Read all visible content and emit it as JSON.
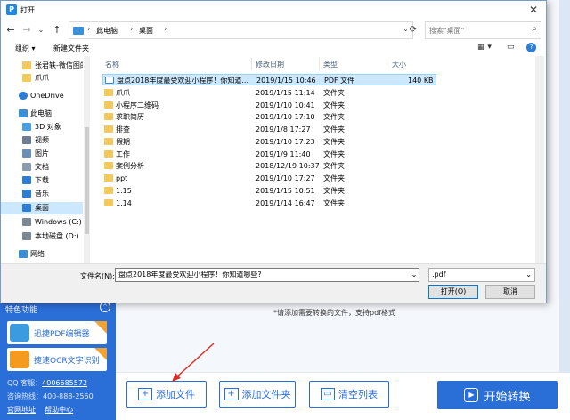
{
  "dialog": {
    "title": "打开",
    "close": "✕",
    "nav": {
      "back": "←",
      "forward": "→",
      "recent": "⌄",
      "up": "↑"
    },
    "address": {
      "crumbs": [
        "此电脑",
        "桌面"
      ],
      "sep": "›",
      "drop": "⌄"
    },
    "refresh": "⟳",
    "search_placeholder": "搜索\"桌面\"",
    "search_icon": "⌕",
    "toolbar": {
      "organize": "组织 ▾",
      "new_folder": "新建文件夹",
      "view": "▦ ▾",
      "pane": "▭",
      "help": "?"
    },
    "sidebar": [
      {
        "label": "张君轶-微信图的",
        "icon": "folder",
        "color": "#f5c85a"
      },
      {
        "label": "爪爪",
        "icon": "folder",
        "color": "#f5c85a"
      },
      {
        "label": "OneDrive",
        "icon": "cloud",
        "color": "#2d7cd6"
      },
      {
        "label": "此电脑",
        "icon": "computer",
        "color": "#3a8fd8"
      },
      {
        "label": "3D 对象",
        "icon": "cube",
        "color": "#4aa0e6"
      },
      {
        "label": "视频",
        "icon": "video",
        "color": "#6b7c93"
      },
      {
        "label": "图片",
        "icon": "picture",
        "color": "#6b8fb8"
      },
      {
        "label": "文档",
        "icon": "document",
        "color": "#8a9bb0"
      },
      {
        "label": "下载",
        "icon": "download",
        "color": "#2d7cd6"
      },
      {
        "label": "音乐",
        "icon": "music",
        "color": "#2d7cd6"
      },
      {
        "label": "桌面",
        "icon": "desktop",
        "color": "#2d7cd6",
        "selected": true
      },
      {
        "label": "Windows (C:)",
        "icon": "drive",
        "color": "#7c8894"
      },
      {
        "label": "本地磁盘 (D:)",
        "icon": "drive",
        "color": "#7c8894"
      },
      {
        "label": "网络",
        "icon": "network",
        "color": "#3a8fd8"
      }
    ],
    "columns": [
      "名称",
      "修改日期",
      "类型",
      "大小"
    ],
    "files": [
      {
        "name": "盘点2018年度最受欢迎小程序！你知道...",
        "date": "2019/1/15 10:46",
        "type": "PDF 文件",
        "size": "140 KB",
        "pdf": true,
        "selected": true
      },
      {
        "name": "爪爪",
        "date": "2019/1/15 11:14",
        "type": "文件夹",
        "size": ""
      },
      {
        "name": "小程序二维码",
        "date": "2019/1/10 10:41",
        "type": "文件夹",
        "size": ""
      },
      {
        "name": "求职简历",
        "date": "2019/1/10 17:10",
        "type": "文件夹",
        "size": ""
      },
      {
        "name": "排查",
        "date": "2019/1/8 17:27",
        "type": "文件夹",
        "size": ""
      },
      {
        "name": "假期",
        "date": "2019/1/10 17:23",
        "type": "文件夹",
        "size": ""
      },
      {
        "name": "工作",
        "date": "2019/1/9 11:40",
        "type": "文件夹",
        "size": ""
      },
      {
        "name": "案例分析",
        "date": "2018/12/19 10:37",
        "type": "文件夹",
        "size": ""
      },
      {
        "name": "ppt",
        "date": "2019/1/10 17:27",
        "type": "文件夹",
        "size": ""
      },
      {
        "name": "1.15",
        "date": "2019/1/15 10:51",
        "type": "文件夹",
        "size": ""
      },
      {
        "name": "1.14",
        "date": "2019/1/14 16:47",
        "type": "文件夹",
        "size": ""
      }
    ],
    "footer": {
      "filename_label": "文件名(N):",
      "filename_value": "盘点2018年度最受欢迎小程序！你知道哪些?",
      "filetype": ".pdf",
      "open": "打开(O)",
      "cancel": "取消"
    }
  },
  "app": {
    "features_title": "特色功能",
    "collapse": "^",
    "features": [
      {
        "label": "迅捷PDF编辑器",
        "icon": "pdf-editor"
      },
      {
        "label": "捷速OCR文字识别",
        "icon": "ocr"
      }
    ],
    "qq_label": "QQ 客服：",
    "qq_value": "4006685572",
    "phone_label": "咨询热线：",
    "phone_value": "400-888-2560",
    "site_link": "官网地址",
    "help_link": "帮助中心",
    "hint": "*请添加需要转换的文件，支持pdf格式",
    "add_file": "添加文件",
    "add_folder": "添加文件夹",
    "clear_list": "清空列表",
    "start": "开始转换",
    "accent": "#2a6ed8"
  }
}
